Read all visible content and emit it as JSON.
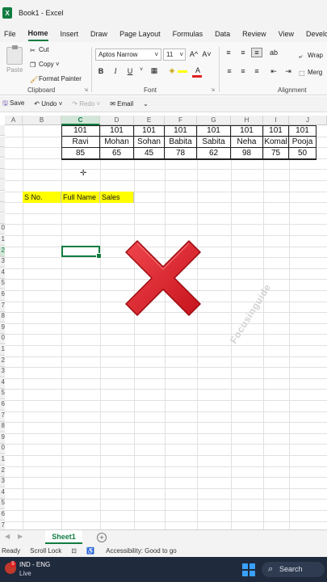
{
  "window": {
    "title": "Book1  -  Excel",
    "logo_letter": "X"
  },
  "menu": [
    "File",
    "Home",
    "Insert",
    "Draw",
    "Page Layout",
    "Formulas",
    "Data",
    "Review",
    "View",
    "Developer"
  ],
  "ribbon": {
    "clipboard": {
      "paste": "Paste",
      "cut": "Cut",
      "copy": "Copy",
      "format_painter": "Format Painter",
      "label": "Clipboard"
    },
    "font": {
      "name": "Aptos Narrow",
      "size": "11",
      "grow": "A^",
      "shrink": "A˅",
      "bold": "B",
      "italic": "I",
      "underline": "U",
      "label": "Font"
    },
    "alignment": {
      "wrap": "Wrap",
      "merge": "Merg",
      "label": "Alignment"
    }
  },
  "qat": {
    "save": "Save",
    "undo": "Undo",
    "redo": "Redo",
    "email": "Email"
  },
  "columns": [
    "A",
    "B",
    "C",
    "D",
    "E",
    "F",
    "G",
    "H",
    "I",
    "J"
  ],
  "row_numbers": [
    "",
    "",
    "",
    "",
    "",
    "",
    "",
    "",
    "",
    "0",
    "1",
    "2",
    "3",
    "4",
    "5",
    "6",
    "7",
    "8",
    "9",
    "0",
    "1",
    "2",
    "3",
    "4",
    "5",
    "6",
    "7",
    "8",
    "9",
    "0",
    "1",
    "2",
    "3",
    "4",
    "5",
    "6",
    "7"
  ],
  "table": {
    "rows": [
      [
        "101",
        "101",
        "101",
        "101",
        "101",
        "101",
        "101",
        "101"
      ],
      [
        "Ravi",
        "Mohan",
        "Sohan",
        "Babita",
        "Sabita",
        "Neha",
        "Komal",
        "Pooja"
      ],
      [
        "85",
        "65",
        "45",
        "78",
        "62",
        "98",
        "75",
        "50"
      ]
    ]
  },
  "header_cells": [
    "S No.",
    "Full Name",
    "Sales"
  ],
  "watermark": "Focusinguide",
  "sheet": {
    "tab": "Sheet1",
    "add": "+"
  },
  "status": {
    "ready": "Ready",
    "scroll_lock": "Scroll Lock",
    "accessibility": "Accessibility: Good to go"
  },
  "taskbar": {
    "lang": "IND - ENG",
    "live": "Live",
    "search": "Search",
    "badge": "5"
  },
  "colors": {
    "excel_green": "#107c41",
    "highlight_yellow": "#ffff00",
    "error_red": "#e8262e"
  }
}
